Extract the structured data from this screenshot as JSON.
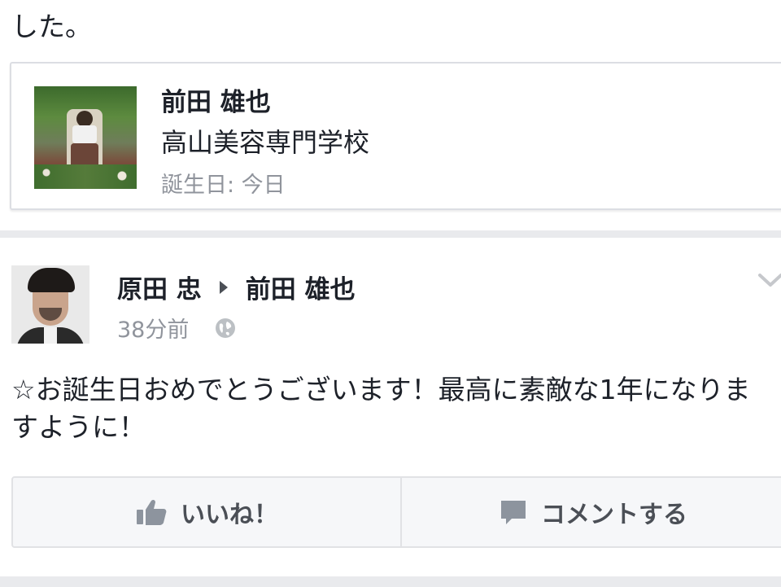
{
  "prev_post": {
    "text_tail": "した。"
  },
  "profile_card": {
    "name": "前田 雄也",
    "school": "高山美容専門学校",
    "birthday": "誕生日: 今日",
    "photo_icon": "profile-photo"
  },
  "story": {
    "author": "原田 忠",
    "target": "前田 雄也",
    "timestamp": "38分前",
    "privacy_icon": "globe-icon",
    "menu_icon": "chevron-down-icon",
    "body": "☆お誕生日おめでとうございます！最高に素敵な1年になりますように！"
  },
  "actions": {
    "like_label": "いいね！",
    "like_icon": "thumbs-up-icon",
    "comment_label": "コメントする",
    "comment_icon": "comment-icon"
  },
  "colors": {
    "text": "#1d2129",
    "meta": "#90949c",
    "action": "#4b4f56",
    "background": "#e9eaed"
  }
}
